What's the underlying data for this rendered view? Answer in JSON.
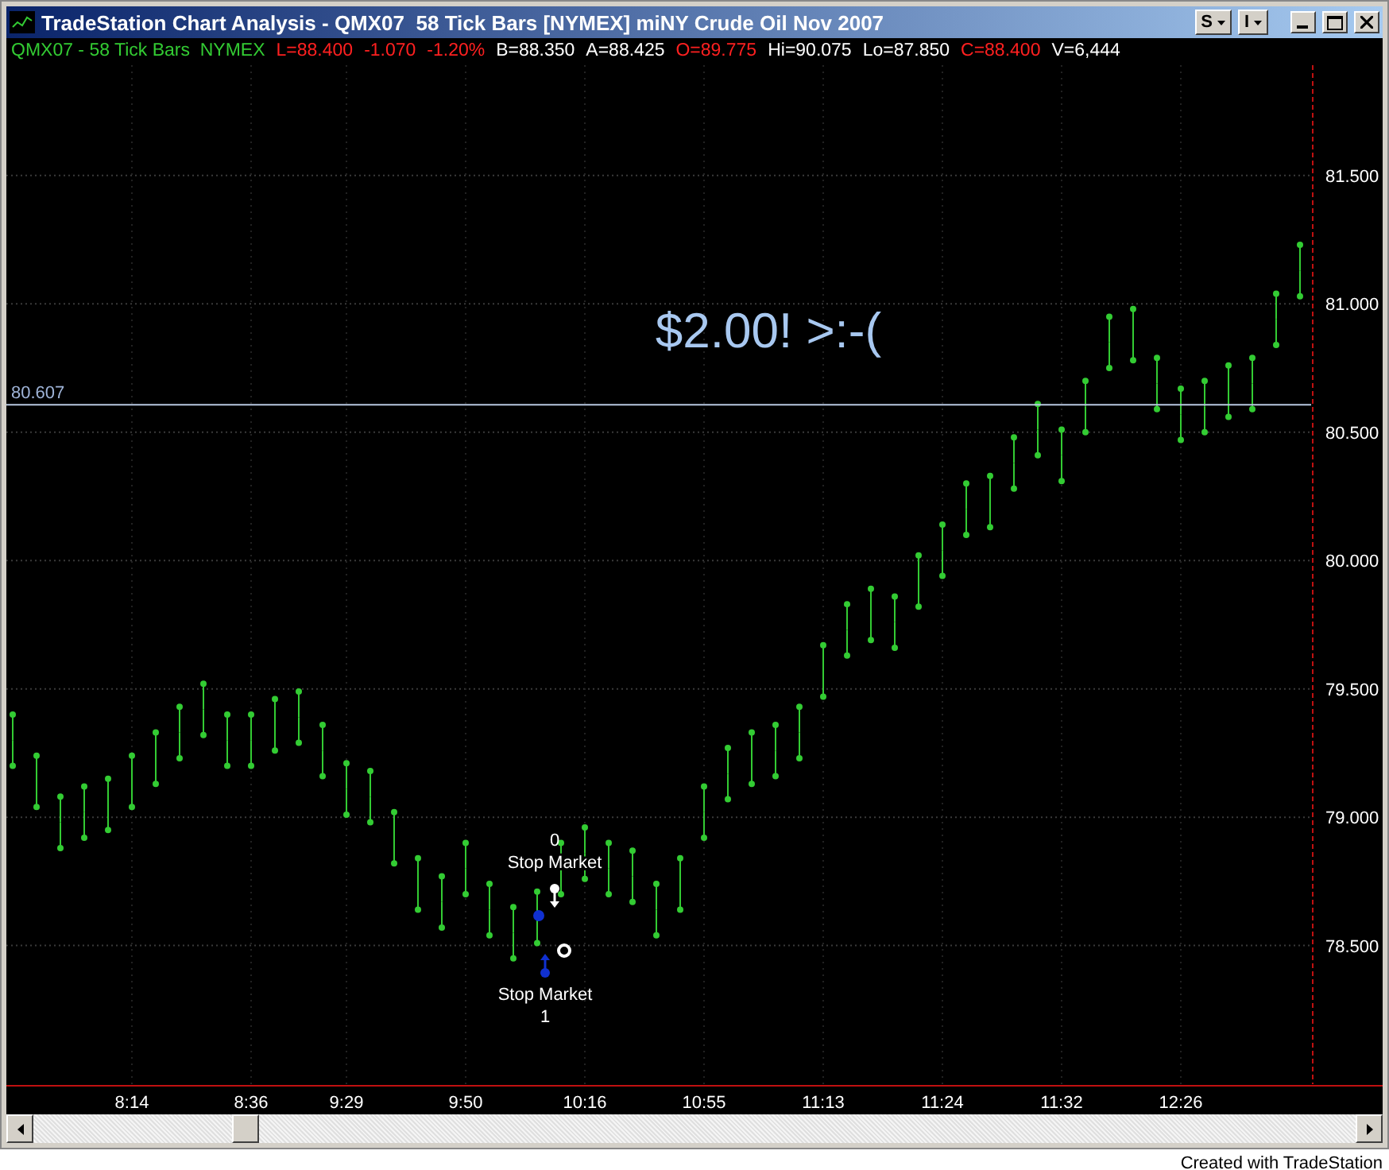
{
  "window": {
    "title": "TradeStation Chart Analysis - QMX07  58 Tick Bars [NYMEX] miNY Crude Oil Nov 2007",
    "menu_buttons": [
      "S",
      "I"
    ]
  },
  "header": {
    "segments": [
      {
        "text": "QMX07 - 58 Tick Bars  NYMEX",
        "color": "#33cc33"
      },
      {
        "text": "L=88.400",
        "color": "#ff2020"
      },
      {
        "text": "-1.070",
        "color": "#ff2020"
      },
      {
        "text": "-1.20%",
        "color": "#ff2020"
      },
      {
        "text": "B=88.350",
        "color": "#ffffff"
      },
      {
        "text": "A=88.425",
        "color": "#ffffff"
      },
      {
        "text": "O=89.775",
        "color": "#ff2020"
      },
      {
        "text": "Hi=90.075",
        "color": "#ffffff"
      },
      {
        "text": "Lo=87.850",
        "color": "#ffffff"
      },
      {
        "text": "C=88.400",
        "color": "#ff2020"
      },
      {
        "text": "V=6,444",
        "color": "#ffffff"
      }
    ]
  },
  "chart": {
    "chart_data": {
      "type": "scatter",
      "ylim": [
        77.96,
        81.93
      ],
      "categories": [
        null,
        null,
        null,
        null,
        null,
        "8:14",
        null,
        null,
        null,
        null,
        "8:36",
        null,
        null,
        null,
        "9:29",
        null,
        null,
        null,
        null,
        "9:50",
        null,
        null,
        null,
        null,
        "10:16",
        null,
        null,
        null,
        null,
        "10:55",
        null,
        null,
        null,
        null,
        "11:13",
        null,
        null,
        null,
        null,
        "11:24",
        null,
        null,
        null,
        null,
        "11:32",
        null,
        null,
        null,
        null,
        "12:26",
        null,
        null,
        null,
        null,
        null
      ],
      "yticks": [
        {
          "value": 78.5,
          "label": "78.500"
        },
        {
          "value": 79,
          "label": "79.000"
        },
        {
          "value": 79.5,
          "label": "79.500"
        },
        {
          "value": 80,
          "label": "80.000"
        },
        {
          "value": 80.5,
          "label": "80.500"
        },
        {
          "value": 81,
          "label": "81.000"
        },
        {
          "value": 81.5,
          "label": "81.500"
        }
      ],
      "series": [
        {
          "color": "#33cc33",
          "values": [
            79.4,
            79.24,
            79.08,
            79.12,
            79.15,
            79.24,
            79.33,
            79.43,
            79.52,
            79.4,
            79.4,
            79.46,
            79.49,
            79.36,
            79.21,
            79.18,
            79.02,
            78.84,
            78.77,
            78.9,
            78.74,
            78.65,
            78.71,
            78.9,
            78.96,
            78.9,
            78.87,
            78.74,
            78.84,
            79.12,
            79.27,
            79.33,
            79.36,
            79.43,
            79.67,
            79.83,
            79.89,
            79.86,
            80.02,
            80.14,
            80.3,
            80.33,
            80.48,
            80.61,
            80.51,
            80.7,
            80.95,
            80.98,
            80.79,
            80.67,
            80.7,
            80.76,
            80.79,
            81.04,
            81.23
          ]
        },
        {
          "color": "#33cc33",
          "values": [
            79.2,
            79.04,
            78.88,
            78.92,
            78.95,
            79.04,
            79.13,
            79.23,
            79.32,
            79.2,
            79.2,
            79.26,
            79.29,
            79.16,
            79.01,
            78.98,
            78.82,
            78.64,
            78.57,
            78.7,
            78.54,
            78.45,
            78.51,
            78.7,
            78.76,
            78.7,
            78.67,
            78.54,
            78.64,
            78.92,
            79.07,
            79.13,
            79.16,
            79.23,
            79.47,
            79.63,
            79.69,
            79.66,
            79.82,
            79.94,
            80.1,
            80.13,
            80.28,
            80.41,
            80.31,
            80.5,
            80.75,
            80.78,
            80.59,
            80.47,
            80.5,
            80.56,
            80.59,
            80.84,
            81.03
          ]
        }
      ],
      "grid": true,
      "ref_lines": [
        {
          "axis": "y",
          "value": 80.607,
          "label": "80.607"
        }
      ],
      "annotations": [
        "$2.00! >:-("
      ]
    },
    "orders": [
      {
        "kind": "above",
        "count": "0",
        "label": "Stop Market"
      },
      {
        "kind": "below",
        "label": "Stop Market",
        "count": "1"
      }
    ]
  },
  "footer": {
    "credit": "Created with TradeStation"
  }
}
